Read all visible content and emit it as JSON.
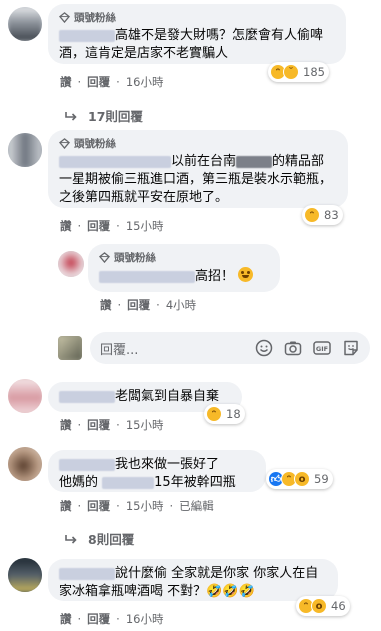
{
  "badge_label": "頭號粉絲",
  "actions": {
    "like": "讚",
    "reply": "回覆",
    "edited": "已編輯"
  },
  "comments": [
    {
      "id": "c1",
      "badge": true,
      "text": "高雄不是發大財嗎？怎麼會有人偷啤酒，這肯定是店家不老實騙人",
      "time": "16小時",
      "reactions": [
        "haha",
        "sad"
      ],
      "reaction_count": "185",
      "replies_label": "17則回覆"
    },
    {
      "id": "c2",
      "badge": true,
      "text_before": "以前在台南",
      "text_after": "的精品部一星期被偷三瓶進口酒，第三瓶是裝水示範瓶，之後第四瓶就平安在原地了。",
      "time": "15小時",
      "reactions": [
        "haha"
      ],
      "reaction_count": "83"
    },
    {
      "id": "c2r1",
      "badge": true,
      "text": "高招！",
      "time": "4小時"
    },
    {
      "id": "c3",
      "badge": false,
      "text": "老闆氣到自暴自棄",
      "time": "15小時",
      "reactions": [
        "haha"
      ],
      "reaction_count": "18"
    },
    {
      "id": "c4",
      "badge": false,
      "line1": "我也來做一張好了",
      "line2_before": "他媽的",
      "line2_after": "15年被幹四瓶",
      "time": "15小時",
      "edited": true,
      "reactions": [
        "like",
        "haha",
        "wow"
      ],
      "reaction_count": "59",
      "replies_label": "8則回覆"
    },
    {
      "id": "c5",
      "badge": false,
      "text": "說什麼偷 全家就是你家 你家人在自家冰箱拿瓶啤酒喝 不對？🤣🤣🤣",
      "time": "16小時",
      "reactions": [
        "haha",
        "wow"
      ],
      "reaction_count": "46"
    }
  ],
  "composer": {
    "placeholder": "回覆..."
  },
  "colors": {
    "bubble": "#f0f2f5",
    "meta": "#65676b",
    "like": "#1877f2",
    "haha": "#f7b928"
  }
}
